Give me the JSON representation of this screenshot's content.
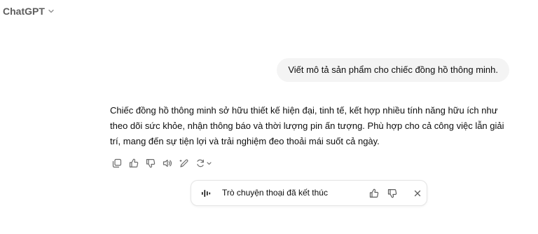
{
  "header": {
    "title": "ChatGPT",
    "dropdown_icon": "chevron-down-icon"
  },
  "conversation": {
    "user_message": "Viết mô tả sản phẩm cho chiếc đồng hồ thông minh.",
    "assistant_message": "Chiếc đồng hồ thông minh sở hữu thiết kế hiện đại, tinh tế, kết hợp nhiều tính năng hữu ích như theo dõi sức khỏe, nhận thông báo và thời lượng pin ấn tượng. Phù hợp cho cả công việc lẫn giải trí, mang đến sự tiện lợi và trải nghiệm đeo thoải mái suốt cả ngày.",
    "action_icons": [
      "copy-icon",
      "thumbs-up-icon",
      "thumbs-down-icon",
      "read-aloud-icon",
      "edit-canvas-icon",
      "regenerate-icon"
    ]
  },
  "voice_banner": {
    "icon": "voice-waveform-icon",
    "text": "Trò chuyện thoại đã kết thúc",
    "buttons": [
      "thumbs-up-icon",
      "thumbs-down-icon",
      "close-icon"
    ]
  }
}
